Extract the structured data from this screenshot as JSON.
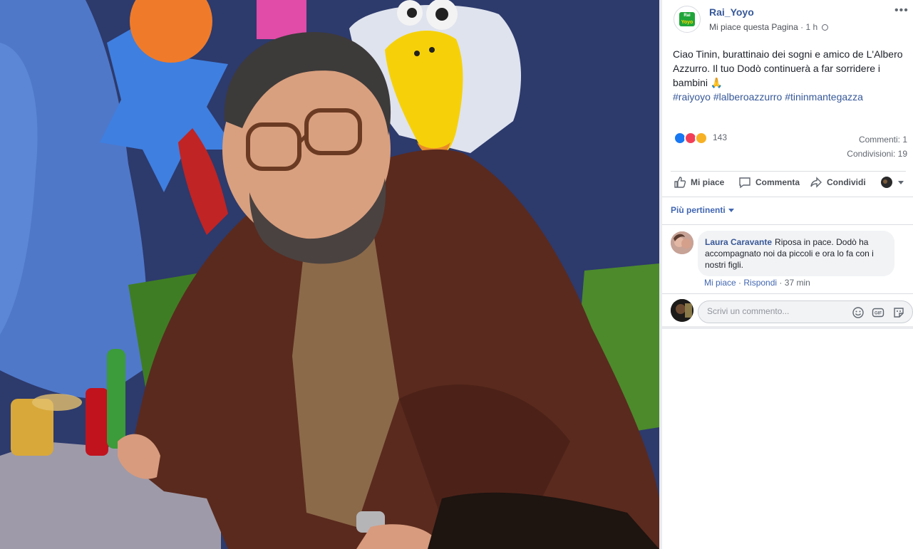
{
  "post": {
    "page_name": "Rai_Yoyo",
    "logo_top": "Rai",
    "logo_bottom": "Yoyo",
    "like_page": "Mi piace questa Pagina",
    "separator": "·",
    "time": "1 h",
    "menu": "•••",
    "text": "Ciao Tinin, burattinaio dei sogni e amico de L'Albero Azzurro. Il tuo Dodò continuerà a far sorridere i bambini 🙏",
    "hashtags": [
      "#raiyoyo",
      "#lalberoazzurro",
      "#tininmantegazza"
    ]
  },
  "stats": {
    "reaction_count": "143",
    "comments": "Commenti: 1",
    "shares": "Condivisioni: 19"
  },
  "actions": {
    "like": "Mi piace",
    "comment": "Commenta",
    "share": "Condividi"
  },
  "sort": {
    "label": "Più pertinenti"
  },
  "comment": {
    "author": "Laura Caravante",
    "text": "Riposa in pace. Dodò ha accompagnato noi da piccoli e ora lo fa con i nostri figli.",
    "like": "Mi piace",
    "reply": "Rispondi",
    "time": "37 min",
    "separator": "·"
  },
  "composer": {
    "placeholder": "Scrivi un commento..."
  },
  "colors": {
    "link": "#365899",
    "accent": "#4267b2",
    "brand_green": "#1fa53a"
  },
  "icons": [
    "more-icon",
    "globe-icon",
    "like-reaction-icon",
    "love-reaction-icon",
    "sad-reaction-icon",
    "thumb-icon",
    "comment-icon",
    "share-icon",
    "emoji-icon",
    "gif-icon",
    "sticker-icon"
  ]
}
